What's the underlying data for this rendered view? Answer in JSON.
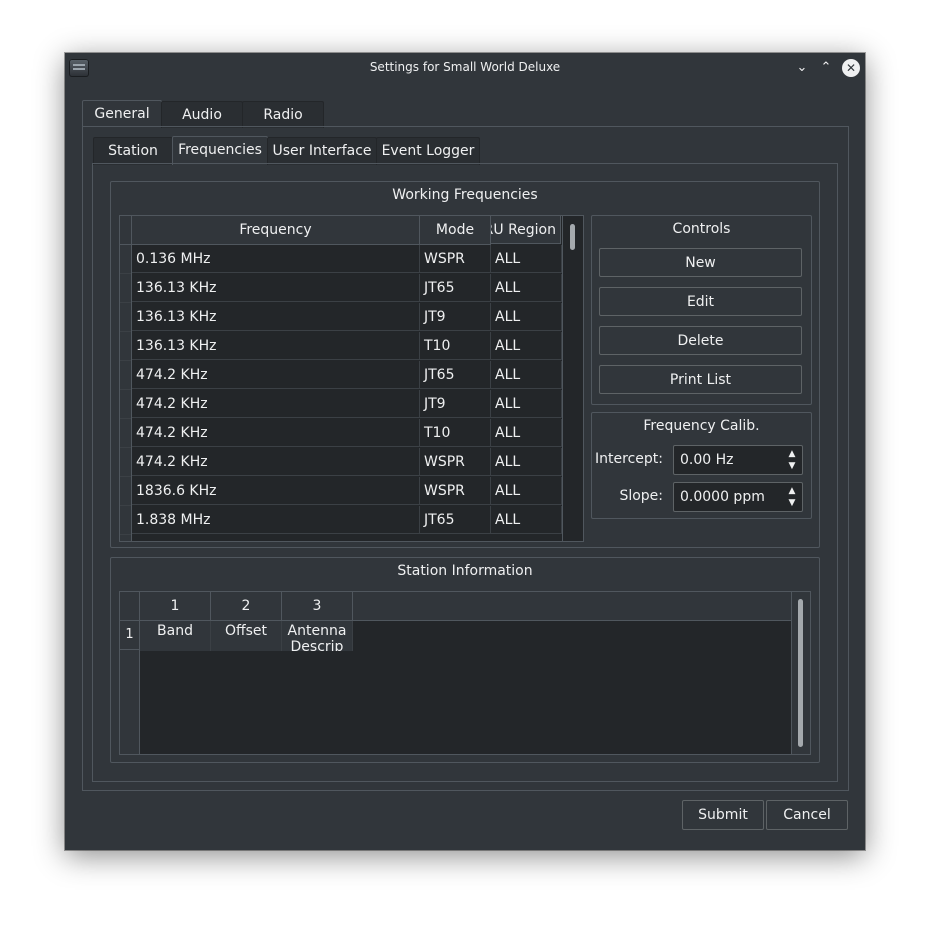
{
  "window": {
    "title": "Settings for Small World Deluxe"
  },
  "titlebar": {
    "minimize_glyph": "⌄",
    "maximize_glyph": "⌃",
    "close_glyph": "✕"
  },
  "main_tabs": [
    {
      "label": "General"
    },
    {
      "label": "Audio"
    },
    {
      "label": "Radio"
    }
  ],
  "sub_tabs": [
    {
      "label": "Station"
    },
    {
      "label": "Frequencies"
    },
    {
      "label": "User Interface"
    },
    {
      "label": "Event Logger"
    }
  ],
  "working_frequencies": {
    "title": "Working Frequencies",
    "columns": [
      "Frequency",
      "Mode",
      "IARU Region"
    ],
    "rows": [
      [
        "0.136 MHz",
        "WSPR",
        "ALL"
      ],
      [
        "136.13 KHz",
        "JT65",
        "ALL"
      ],
      [
        "136.13 KHz",
        "JT9",
        "ALL"
      ],
      [
        "136.13 KHz",
        "T10",
        "ALL"
      ],
      [
        "474.2 KHz",
        "JT65",
        "ALL"
      ],
      [
        "474.2 KHz",
        "JT9",
        "ALL"
      ],
      [
        "474.2 KHz",
        "T10",
        "ALL"
      ],
      [
        "474.2 KHz",
        "WSPR",
        "ALL"
      ],
      [
        "1836.6 KHz",
        "WSPR",
        "ALL"
      ],
      [
        "1.838 MHz",
        "JT65",
        "ALL"
      ]
    ]
  },
  "controls": {
    "title": "Controls",
    "new_label": "New",
    "edit_label": "Edit",
    "delete_label": "Delete",
    "print_label": "Print List"
  },
  "calibration": {
    "title": "Frequency Calib.",
    "intercept_label": "Intercept:",
    "intercept_value": "0.00 Hz",
    "slope_label": "Slope:",
    "slope_value": "0.0000 ppm"
  },
  "station_info": {
    "title": "Station Information",
    "col_numbers": [
      "1",
      "2",
      "3"
    ],
    "row_number": "1",
    "cells": [
      "Band",
      "Offset",
      "Antenna Descrip"
    ]
  },
  "dialog": {
    "submit_label": "Submit",
    "cancel_label": "Cancel"
  },
  "colors": {
    "window_bg": "#31363b",
    "view_bg": "#232629",
    "border": "#50575e",
    "text": "#eff0f1"
  }
}
